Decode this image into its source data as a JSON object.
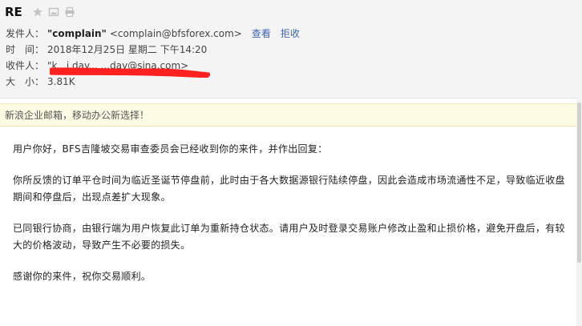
{
  "header": {
    "subject": "RE",
    "icons": [
      "star-icon",
      "image-icon",
      "print-icon"
    ],
    "from": {
      "label": "发件人：",
      "name": "\"complain\"",
      "email": "<complain@bfsforex.com>",
      "view_link": "查看",
      "reject_link": "拒收"
    },
    "time": {
      "label": "时　间：",
      "value": "2018年12月25日 星期二 下午14:20"
    },
    "to": {
      "label": "收件人：",
      "value": "\"k...i.day...   ...day@sina.com>"
    },
    "size": {
      "label": "大　小：",
      "value": "3.81K"
    }
  },
  "banner": {
    "text": "新浪企业邮箱，移动办公新选择！"
  },
  "body": {
    "paragraphs": [
      "用户你好，BFS吉隆坡交易审查委员会已经收到你的来件，并作出回复：",
      "你所反馈的订单平仓时间为临近圣诞节停盘前，此时由于各大数据源银行陆续停盘，因此会造成市场流通性不足，导致临近收盘期间和停盘后，出现点差扩大现象。",
      "已同银行协商，由银行端为用户恢复此订单为重新持仓状态。请用户及时登录交易账户修改止盈和止损价格，避免开盘后，有较大的价格波动，导致产生不必要的损失。",
      "感谢你的来件，祝你交易顺利。"
    ]
  },
  "colors": {
    "link": "#3b66b4",
    "redact": "#ff2020",
    "banner_bg": "#fdfbe3"
  }
}
